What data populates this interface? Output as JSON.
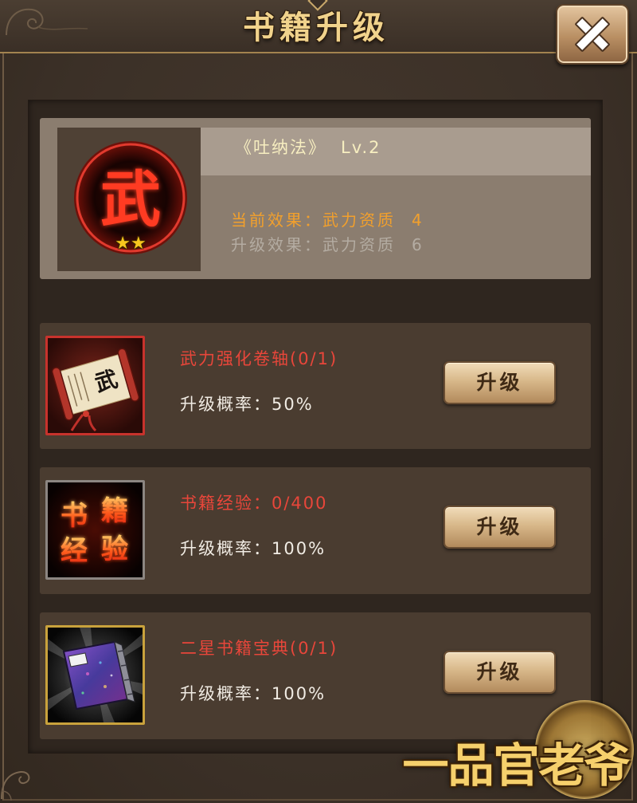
{
  "header": {
    "title": "书籍升级",
    "close_icon": "close-icon"
  },
  "book": {
    "emblem_char": "武",
    "emblem_icon": "martial-emblem-icon",
    "stars": 2,
    "title": "《吐纳法》",
    "level": "Lv.2",
    "current_effect": {
      "label": "当前效果：",
      "attribute": "武力资质",
      "value": "4"
    },
    "upgrade_effect": {
      "label": "升级效果：",
      "attribute": "武力资质",
      "value": "6"
    }
  },
  "materials": [
    {
      "name": "武力强化卷轴(0/1)",
      "rate_label": "升级概率：",
      "rate": "50%",
      "button": "升级",
      "icon": "scroll-icon",
      "icon_char": "武",
      "frame_color": "#c8322c"
    },
    {
      "name": "书籍经验：0/400",
      "rate_label": "升级概率：",
      "rate": "100%",
      "button": "升级",
      "icon": "book-experience-icon",
      "icon_text": [
        "书",
        "籍",
        "经",
        "验"
      ],
      "frame_color": "#8c8682"
    },
    {
      "name": "二星书籍宝典(0/1)",
      "rate_label": "升级概率：",
      "rate": "100%",
      "button": "升级",
      "icon": "book-tome-icon",
      "frame_color": "#c9a23c"
    }
  ],
  "logo": {
    "text": "一品官老爷"
  },
  "colors": {
    "title": "#f1d38c",
    "book_title": "#f7eec0",
    "current_effect": "#f2a02c",
    "upgrade_effect": "#b4aca2",
    "material_name": "#e8463a",
    "rate_text": "#f1ece4",
    "button_text": "#3f2a15"
  }
}
